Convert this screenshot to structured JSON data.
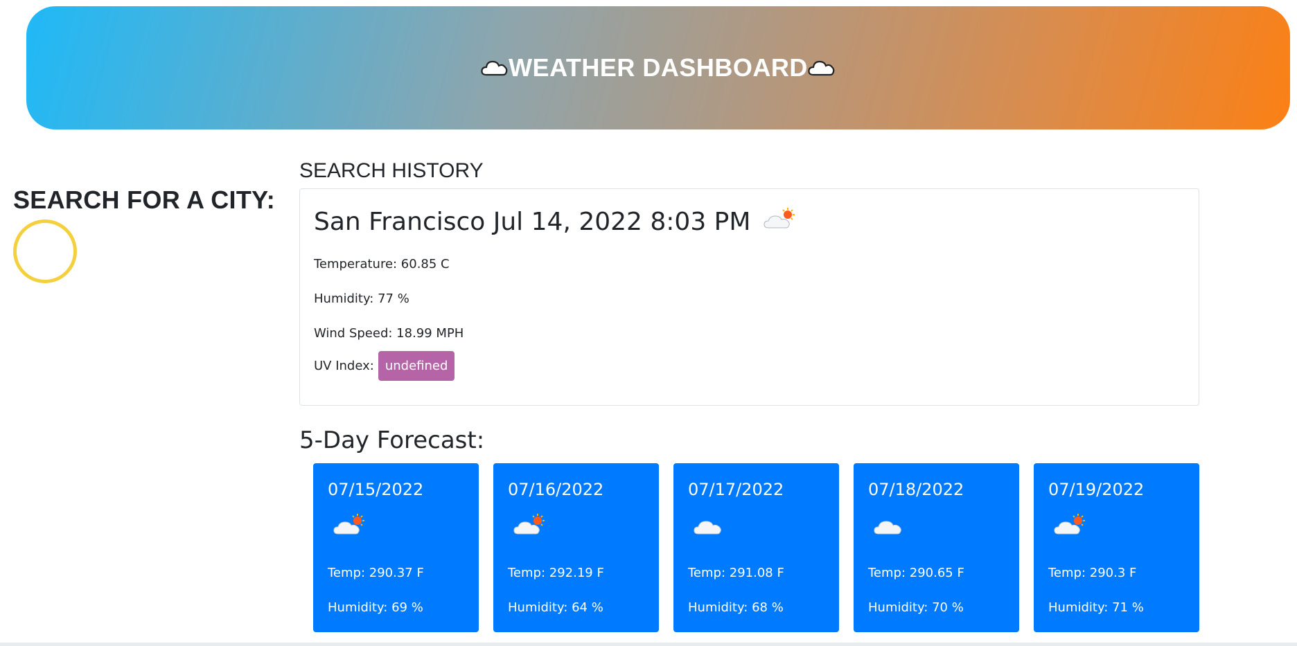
{
  "header": {
    "title": "WEATHER DASHBOARD",
    "left_icon": "cloud-icon",
    "right_icon": "cloud-icon"
  },
  "search": {
    "title": "SEARCH FOR A CITY:",
    "spinner_color": "#f4d03f"
  },
  "history": {
    "title": "SEARCH HISTORY"
  },
  "current": {
    "heading": "San Francisco Jul 14, 2022 8:03 PM",
    "icon": "partly-cloudy-icon",
    "temperature": "Temperature: 60.85 C",
    "humidity": "Humidity: 77 %",
    "wind": "Wind Speed: 18.99 MPH",
    "uv_label": "UV Index:",
    "uv_value": "undefined",
    "uv_color": "#b565a7"
  },
  "forecast": {
    "title": "5-Day Forecast:",
    "card_color": "#007bff",
    "days": [
      {
        "date": "07/15/2022",
        "icon": "partly-cloudy-icon",
        "temp": "Temp: 290.37 F",
        "humidity": "Humidity: 69 %"
      },
      {
        "date": "07/16/2022",
        "icon": "partly-cloudy-icon",
        "temp": "Temp: 292.19 F",
        "humidity": "Humidity: 64 %"
      },
      {
        "date": "07/17/2022",
        "icon": "cloud-icon",
        "temp": "Temp: 291.08 F",
        "humidity": "Humidity: 68 %"
      },
      {
        "date": "07/18/2022",
        "icon": "cloud-icon",
        "temp": "Temp: 290.65 F",
        "humidity": "Humidity: 70 %"
      },
      {
        "date": "07/19/2022",
        "icon": "partly-cloudy-icon",
        "temp": "Temp: 290.3 F",
        "humidity": "Humidity: 71 %"
      }
    ]
  }
}
